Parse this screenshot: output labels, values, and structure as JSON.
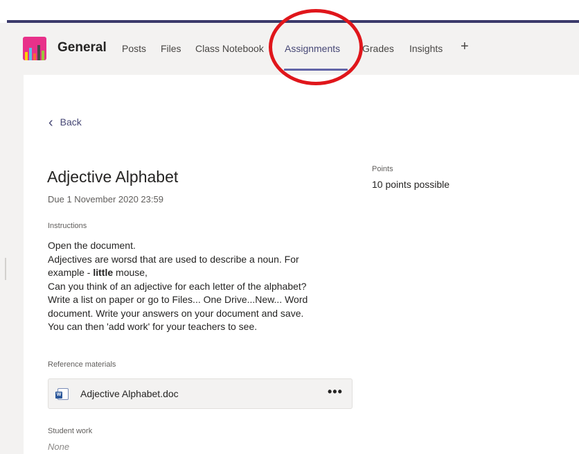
{
  "header": {
    "team_name": "General",
    "tabs": [
      {
        "label": "Posts"
      },
      {
        "label": "Files"
      },
      {
        "label": "Class Notebook"
      },
      {
        "label": "Assignments",
        "active": true
      },
      {
        "label": "Grades"
      },
      {
        "label": "Insights"
      }
    ],
    "add_tab_icon": "plus-icon"
  },
  "back_label": "Back",
  "assignment": {
    "title": "Adjective Alphabet",
    "due": "Due 1 November 2020 23:59",
    "points_label": "Points",
    "points_value": "10 points possible",
    "instructions_label": "Instructions",
    "instructions_lines": [
      "Open the document.",
      "Adjectives are worsd that are used to describe a noun. For",
      "example - ",
      "little",
      " mouse,",
      "Can you think of an adjective for each letter of the alphabet?",
      "Write a list on paper or go to Files... One Drive...New... Word",
      "document. Write your answers on your document and save.",
      "You can then 'add work' for your teachers to see."
    ],
    "reference_label": "Reference materials",
    "reference_file": "Adjective Alphabet.doc",
    "student_work_label": "Student work",
    "student_work_value": "None"
  },
  "colors": {
    "accent": "#6264a7",
    "annotation_circle": "#e0161b",
    "team_logo": "#e8318a"
  }
}
